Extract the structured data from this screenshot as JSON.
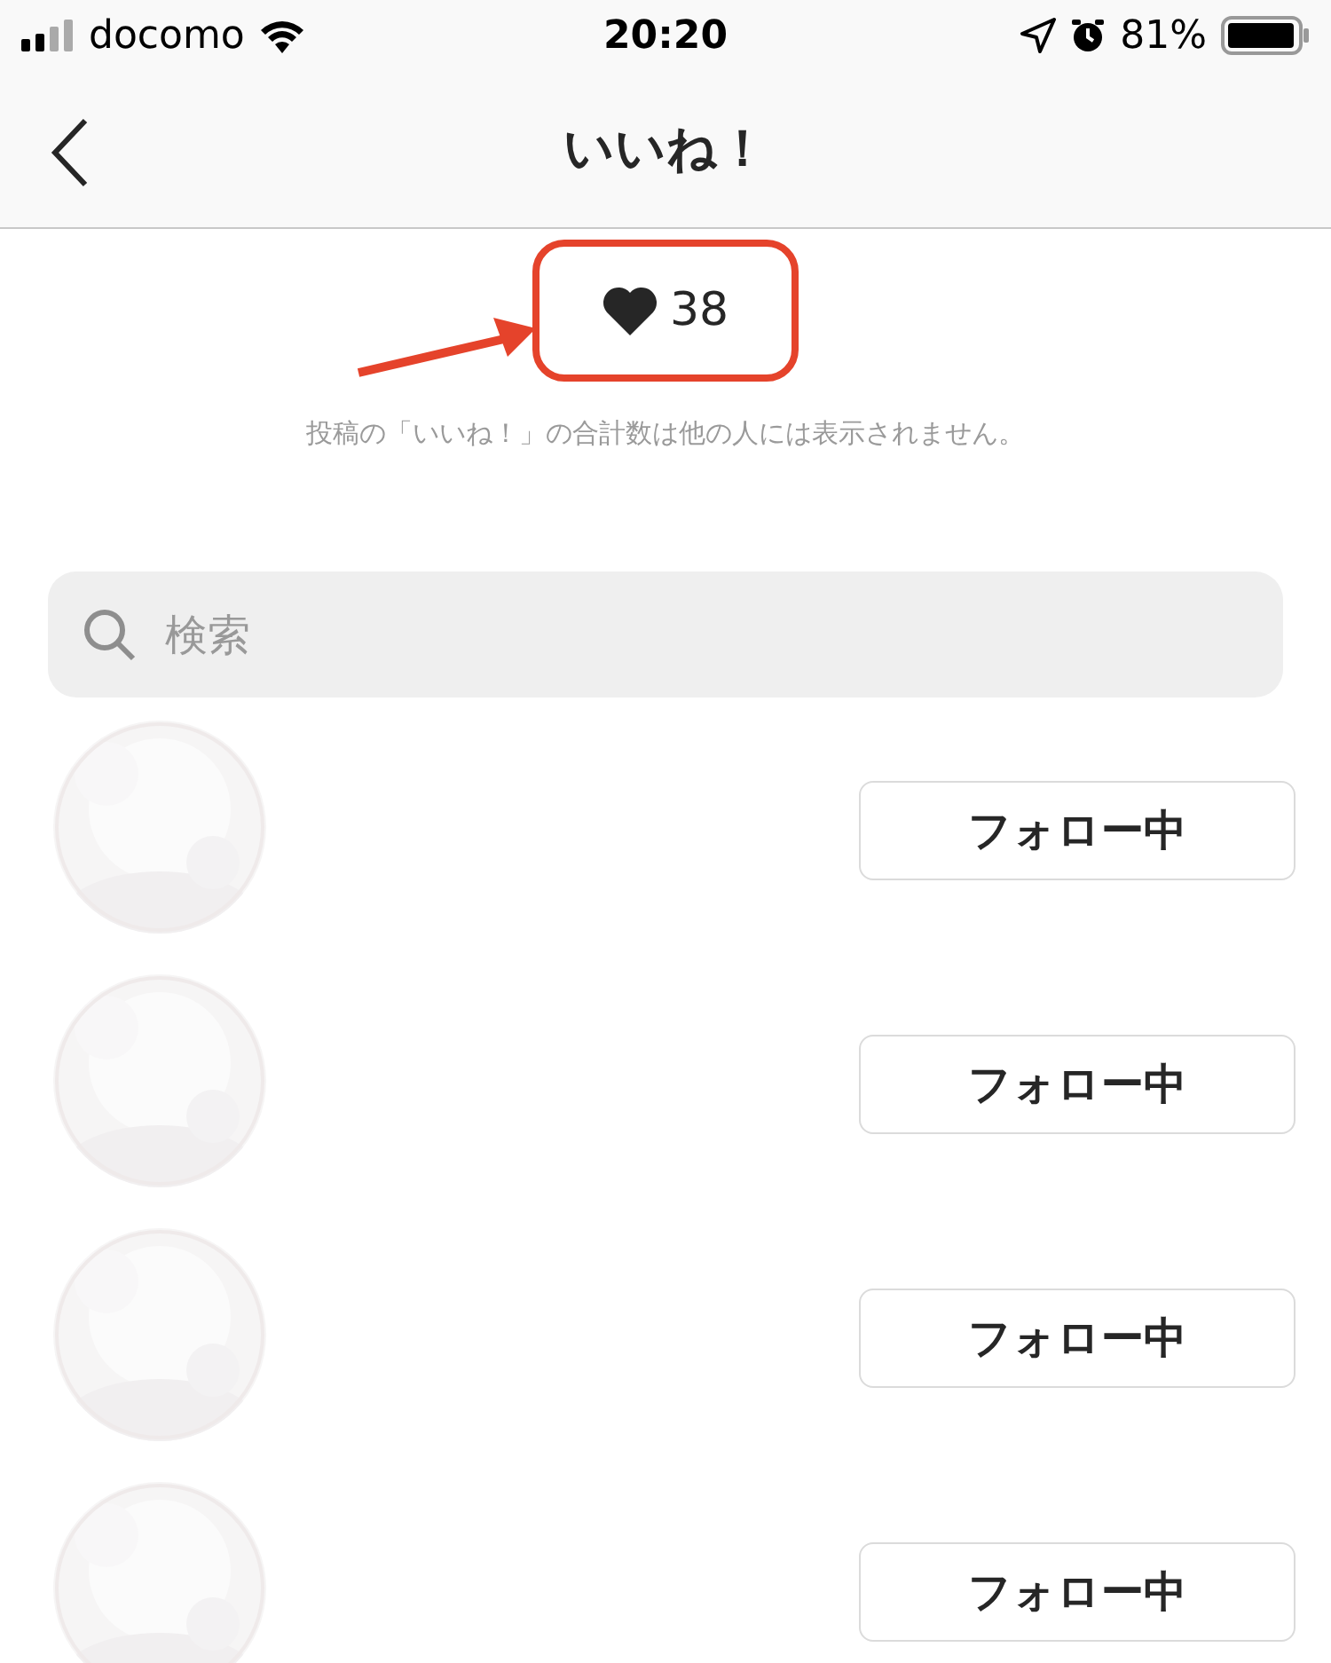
{
  "status_bar": {
    "carrier": "docomo",
    "time": "20:20",
    "battery": "81%"
  },
  "nav": {
    "title": "いいね！"
  },
  "likes": {
    "count": "38",
    "note": "投稿の「いいね！」の合計数は他の人には表示されません。"
  },
  "search": {
    "placeholder": "検索"
  },
  "users": [
    {
      "button": "フォロー中"
    },
    {
      "button": "フォロー中"
    },
    {
      "button": "フォロー中"
    },
    {
      "button": "フォロー中"
    }
  ]
}
